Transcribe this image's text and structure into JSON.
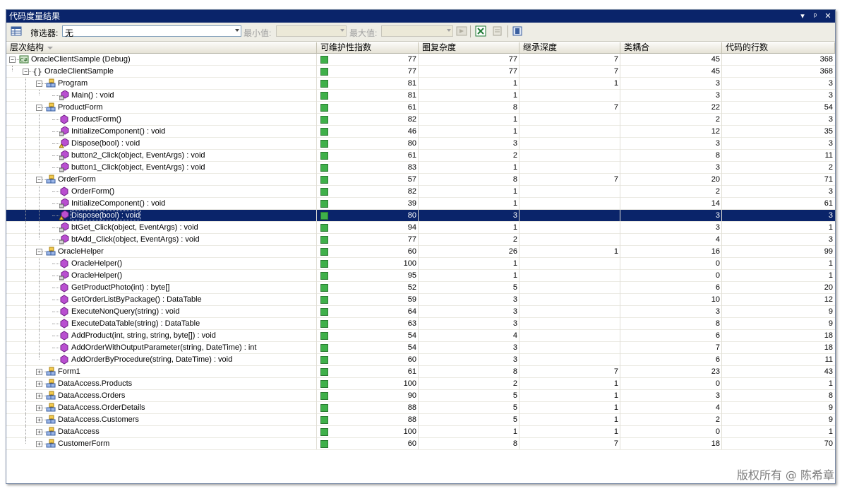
{
  "window": {
    "title": "代码度量结果",
    "controls": [
      "▾",
      "ᵖ",
      "✕"
    ]
  },
  "toolbar": {
    "filter_label": "筛选器:",
    "filter_value": "无",
    "min_label": "最小值:",
    "max_label": "最大值:"
  },
  "columns": [
    "层次结构",
    "可维护性指数",
    "圈复杂度",
    "继承深度",
    "类耦合",
    "代码的行数"
  ],
  "rows": [
    {
      "name": "OracleClientSample (Debug)",
      "level": 0,
      "exp": "-",
      "icon": "project",
      "mi": "77",
      "cc": "77",
      "di": "7",
      "cp": "45",
      "loc": "368"
    },
    {
      "name": "OracleClientSample",
      "level": 1,
      "exp": "-",
      "icon": "namespace",
      "mi": "77",
      "cc": "77",
      "di": "7",
      "cp": "45",
      "loc": "368"
    },
    {
      "name": "Program",
      "level": 2,
      "exp": "-",
      "icon": "class",
      "mi": "81",
      "cc": "1",
      "di": "1",
      "cp": "3",
      "loc": "3"
    },
    {
      "name": "Main() : void",
      "level": 3,
      "exp": "",
      "icon": "method-lock",
      "mi": "81",
      "cc": "1",
      "di": "",
      "cp": "3",
      "loc": "3"
    },
    {
      "name": "ProductForm",
      "level": 2,
      "exp": "-",
      "icon": "class",
      "mi": "61",
      "cc": "8",
      "di": "7",
      "cp": "22",
      "loc": "54"
    },
    {
      "name": "ProductForm()",
      "level": 3,
      "exp": "",
      "icon": "method",
      "mi": "82",
      "cc": "1",
      "di": "",
      "cp": "2",
      "loc": "3"
    },
    {
      "name": "InitializeComponent() : void",
      "level": 3,
      "exp": "",
      "icon": "method-lock",
      "mi": "46",
      "cc": "1",
      "di": "",
      "cp": "12",
      "loc": "35"
    },
    {
      "name": "Dispose(bool) : void",
      "level": 3,
      "exp": "",
      "icon": "method-prot",
      "mi": "80",
      "cc": "3",
      "di": "",
      "cp": "3",
      "loc": "3"
    },
    {
      "name": "button2_Click(object, EventArgs) : void",
      "level": 3,
      "exp": "",
      "icon": "method-lock",
      "mi": "61",
      "cc": "2",
      "di": "",
      "cp": "8",
      "loc": "11"
    },
    {
      "name": "button1_Click(object, EventArgs) : void",
      "level": 3,
      "exp": "",
      "icon": "method-lock",
      "mi": "83",
      "cc": "1",
      "di": "",
      "cp": "3",
      "loc": "2"
    },
    {
      "name": "OrderForm",
      "level": 2,
      "exp": "-",
      "icon": "class",
      "mi": "57",
      "cc": "8",
      "di": "7",
      "cp": "20",
      "loc": "71"
    },
    {
      "name": "OrderForm()",
      "level": 3,
      "exp": "",
      "icon": "method",
      "mi": "82",
      "cc": "1",
      "di": "",
      "cp": "2",
      "loc": "3"
    },
    {
      "name": "InitializeComponent() : void",
      "level": 3,
      "exp": "",
      "icon": "method-lock",
      "mi": "39",
      "cc": "1",
      "di": "",
      "cp": "14",
      "loc": "61"
    },
    {
      "name": "Dispose(bool) : void",
      "level": 3,
      "exp": "",
      "icon": "method-prot",
      "mi": "80",
      "cc": "3",
      "di": "",
      "cp": "3",
      "loc": "3",
      "selected": true
    },
    {
      "name": "btGet_Click(object, EventArgs) : void",
      "level": 3,
      "exp": "",
      "icon": "method-lock",
      "mi": "94",
      "cc": "1",
      "di": "",
      "cp": "3",
      "loc": "1"
    },
    {
      "name": "btAdd_Click(object, EventArgs) : void",
      "level": 3,
      "exp": "",
      "icon": "method-lock",
      "mi": "77",
      "cc": "2",
      "di": "",
      "cp": "4",
      "loc": "3"
    },
    {
      "name": "OracleHelper",
      "level": 2,
      "exp": "-",
      "icon": "class",
      "mi": "60",
      "cc": "26",
      "di": "1",
      "cp": "16",
      "loc": "99"
    },
    {
      "name": "OracleHelper()",
      "level": 3,
      "exp": "",
      "icon": "method",
      "mi": "100",
      "cc": "1",
      "di": "",
      "cp": "0",
      "loc": "1"
    },
    {
      "name": "OracleHelper()",
      "level": 3,
      "exp": "",
      "icon": "method-lock",
      "mi": "95",
      "cc": "1",
      "di": "",
      "cp": "0",
      "loc": "1"
    },
    {
      "name": "GetProductPhoto(int) : byte[]",
      "level": 3,
      "exp": "",
      "icon": "method",
      "mi": "52",
      "cc": "5",
      "di": "",
      "cp": "6",
      "loc": "20"
    },
    {
      "name": "GetOrderListByPackage() : DataTable",
      "level": 3,
      "exp": "",
      "icon": "method",
      "mi": "59",
      "cc": "3",
      "di": "",
      "cp": "10",
      "loc": "12"
    },
    {
      "name": "ExecuteNonQuery(string) : void",
      "level": 3,
      "exp": "",
      "icon": "method",
      "mi": "64",
      "cc": "3",
      "di": "",
      "cp": "3",
      "loc": "9"
    },
    {
      "name": "ExecuteDataTable(string) : DataTable",
      "level": 3,
      "exp": "",
      "icon": "method",
      "mi": "63",
      "cc": "3",
      "di": "",
      "cp": "8",
      "loc": "9"
    },
    {
      "name": "AddProduct(int, string, string, byte[]) : void",
      "level": 3,
      "exp": "",
      "icon": "method",
      "mi": "54",
      "cc": "4",
      "di": "",
      "cp": "6",
      "loc": "18"
    },
    {
      "name": "AddOrderWithOutputParameter(string, DateTime) : int",
      "level": 3,
      "exp": "",
      "icon": "method",
      "mi": "54",
      "cc": "3",
      "di": "",
      "cp": "7",
      "loc": "18"
    },
    {
      "name": "AddOrderByProcedure(string, DateTime) : void",
      "level": 3,
      "exp": "",
      "icon": "method",
      "mi": "60",
      "cc": "3",
      "di": "",
      "cp": "6",
      "loc": "11"
    },
    {
      "name": "Form1",
      "level": 2,
      "exp": "+",
      "icon": "class",
      "mi": "61",
      "cc": "8",
      "di": "7",
      "cp": "23",
      "loc": "43"
    },
    {
      "name": "DataAccess.Products",
      "level": 2,
      "exp": "+",
      "icon": "class",
      "mi": "100",
      "cc": "2",
      "di": "1",
      "cp": "0",
      "loc": "1"
    },
    {
      "name": "DataAccess.Orders",
      "level": 2,
      "exp": "+",
      "icon": "class",
      "mi": "90",
      "cc": "5",
      "di": "1",
      "cp": "3",
      "loc": "8"
    },
    {
      "name": "DataAccess.OrderDetails",
      "level": 2,
      "exp": "+",
      "icon": "class",
      "mi": "88",
      "cc": "5",
      "di": "1",
      "cp": "4",
      "loc": "9"
    },
    {
      "name": "DataAccess.Customers",
      "level": 2,
      "exp": "+",
      "icon": "class",
      "mi": "88",
      "cc": "5",
      "di": "1",
      "cp": "2",
      "loc": "9"
    },
    {
      "name": "DataAccess",
      "level": 2,
      "exp": "+",
      "icon": "class",
      "mi": "100",
      "cc": "1",
      "di": "1",
      "cp": "0",
      "loc": "1"
    },
    {
      "name": "CustomerForm",
      "level": 2,
      "exp": "+",
      "icon": "class",
      "mi": "60",
      "cc": "8",
      "di": "7",
      "cp": "18",
      "loc": "70"
    }
  ],
  "footer": {
    "watermark": "版权所有 @ 陈希章"
  },
  "colors": {
    "title_bg": "#0a246a",
    "selected_bg": "#0a246a",
    "good_index": "#3fb04a"
  }
}
